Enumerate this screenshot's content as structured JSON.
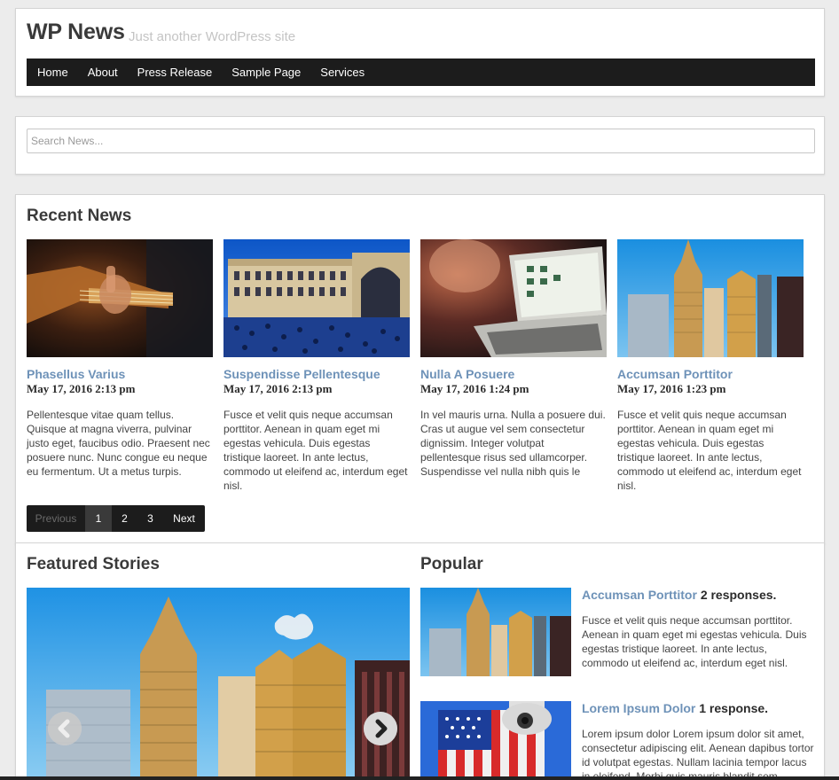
{
  "site": {
    "title": "WP News",
    "tagline": "Just another WordPress site"
  },
  "menu": [
    "Home",
    "About",
    "Press Release",
    "Sample Page",
    "Services"
  ],
  "search": {
    "placeholder": "Search News..."
  },
  "recent": {
    "title": "Recent News",
    "posts": [
      {
        "title": "Phasellus Varius",
        "date": "May 17, 2016 2:13 pm",
        "excerpt": "Pellentesque vitae quam tellus. Quisque at magna viverra, pulvinar justo eget, faucibus odio. Praesent nec posuere nunc. Nunc congue eu neque eu fermentum. Ut a metus turpis."
      },
      {
        "title": "Suspendisse Pellentesque",
        "date": "May 17, 2016 2:13 pm",
        "excerpt": "Fusce et velit quis neque accumsan porttitor. Aenean in quam eget mi egestas vehicula. Duis egestas tristique laoreet. In ante lectus, commodo ut eleifend ac, interdum eget nisl."
      },
      {
        "title": "Nulla A Posuere",
        "date": "May 17, 2016 1:24 pm",
        "excerpt": "In vel mauris urna. Nulla a posuere dui. Cras ut augue vel sem consectetur dignissim. Integer volutpat pellentesque risus sed ullamcorper. Suspendisse vel nulla nibh quis le"
      },
      {
        "title": "Accumsan Porttitor",
        "date": "May 17, 2016 1:23 pm",
        "excerpt": "Fusce et velit quis neque accumsan porttitor. Aenean in quam eget mi egestas vehicula. Duis egestas tristique laoreet. In ante lectus, commodo ut eleifend ac, interdum eget nisl."
      }
    ],
    "pager": {
      "prev": "Previous",
      "pages": [
        "1",
        "2",
        "3"
      ],
      "next": "Next",
      "current": "1"
    }
  },
  "featured": {
    "title": "Featured Stories"
  },
  "popular": {
    "title": "Popular",
    "items": [
      {
        "title": "Accumsan Porttitor",
        "responses": "2 responses.",
        "excerpt": "Fusce et velit quis neque accumsan porttitor. Aenean in quam eget mi egestas vehicula. Duis egestas tristique laoreet. In ante lectus, commodo ut eleifend ac, interdum eget nisl."
      },
      {
        "title": "Lorem Ipsum Dolor",
        "responses": "1 response.",
        "excerpt": "Lorem ipsum dolor Lorem ipsum dolor sit amet, consectetur adipiscing elit. Aenean dapibus tortor id volutpat egestas. Nullam lacinia tempor lacus in eleifend. Morbi quis mauris blandit sem"
      }
    ]
  },
  "colors": {
    "accent_link": "#6e92b8",
    "nav_bg": "#1c1c1c",
    "page_bg": "#ececec"
  }
}
